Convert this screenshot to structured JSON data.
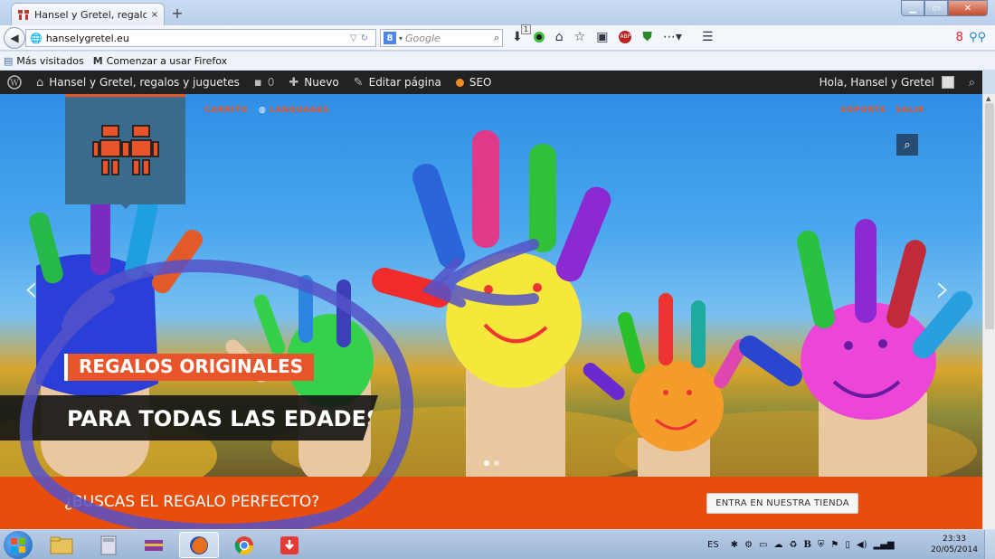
{
  "browser": {
    "tab_title": "Hansel y Gretel, regalos y jugu...",
    "tab_close": "×",
    "new_tab": "+",
    "url": "hanselygretel.eu",
    "search_engine_badge": "8",
    "search_placeholder": "Google",
    "download_count": "1",
    "window_buttons": {
      "minimize": "▁",
      "maximize": "▭",
      "close": "✕"
    }
  },
  "bookmarks": [
    {
      "label": "Más visitados",
      "icon": "bookmark-icon"
    },
    {
      "label": "Comenzar a usar Firefox",
      "icon": "firefox-m-icon"
    }
  ],
  "admin_bar": {
    "site_name": "Hansel y Gretel, regalos y juguetes",
    "comments_count": "0",
    "new_label": "Nuevo",
    "edit_label": "Editar página",
    "seo_label": "SEO",
    "greeting": "Hola, Hansel y Gretel"
  },
  "hero": {
    "top_menu_left": [
      "CARRITO",
      "LANGUAGES"
    ],
    "top_menu_right": [
      "SOPORTE",
      "SALIR"
    ],
    "caption_primary": "REGALOS ORIGINALES",
    "caption_secondary": "PARA TODAS LAS EDADES",
    "slides": 2,
    "active_slide": 1,
    "prev_arrow": "‹",
    "next_arrow": "›"
  },
  "banner": {
    "text": "¿BUSCAS EL REGALO PERFECTO?",
    "button_label": "ENTRA EN NUESTRA TIENDA"
  },
  "taskbar": {
    "language": "ES",
    "time": "23:33",
    "date": "20/05/2014"
  },
  "colors": {
    "brand_orange": "#e8552a",
    "banner_orange": "#e84d0c",
    "logo_blue": "#3c6c8b",
    "admin_bar": "#222222",
    "annotation_stroke": "#5552c8"
  }
}
